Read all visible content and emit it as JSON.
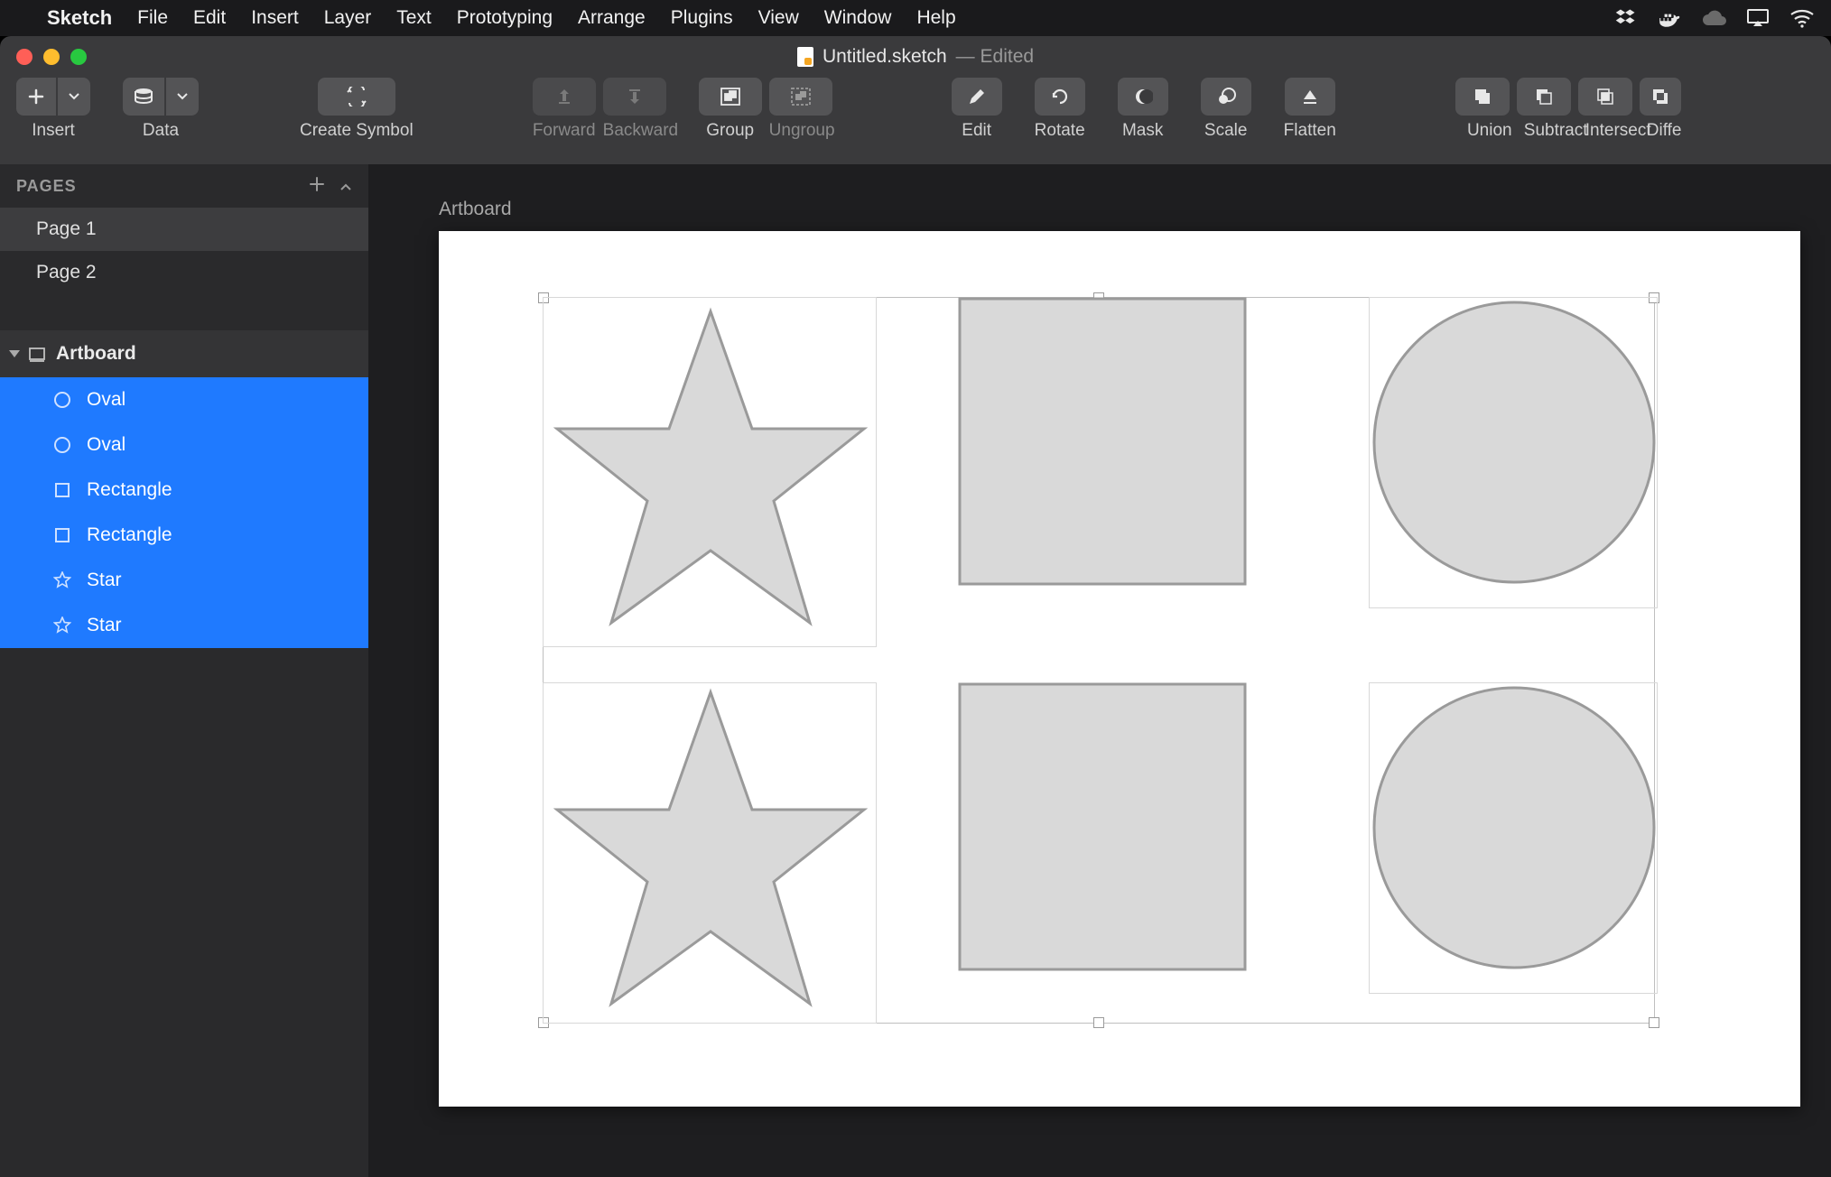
{
  "menubar": {
    "app_name": "Sketch",
    "items": [
      "File",
      "Edit",
      "Insert",
      "Layer",
      "Text",
      "Prototyping",
      "Arrange",
      "Plugins",
      "View",
      "Window",
      "Help"
    ]
  },
  "titlebar": {
    "filename": "Untitled.sketch",
    "edited_suffix": " — Edited"
  },
  "toolbar": {
    "insert": "Insert",
    "data": "Data",
    "create_symbol": "Create Symbol",
    "forward": "Forward",
    "backward": "Backward",
    "group": "Group",
    "ungroup": "Ungroup",
    "edit": "Edit",
    "rotate": "Rotate",
    "mask": "Mask",
    "scale": "Scale",
    "flatten": "Flatten",
    "union": "Union",
    "subtract": "Subtract",
    "intersect": "Intersect",
    "difference": "Diffe"
  },
  "sidebar": {
    "pages_label": "PAGES",
    "pages": [
      "Page 1",
      "Page 2"
    ],
    "artboard_label": "Artboard",
    "layers": [
      {
        "name": "Oval",
        "icon": "oval"
      },
      {
        "name": "Oval",
        "icon": "oval"
      },
      {
        "name": "Rectangle",
        "icon": "rect"
      },
      {
        "name": "Rectangle",
        "icon": "rect"
      },
      {
        "name": "Star",
        "icon": "star"
      },
      {
        "name": "Star",
        "icon": "star"
      }
    ]
  },
  "canvas": {
    "artboard_title": "Artboard"
  }
}
